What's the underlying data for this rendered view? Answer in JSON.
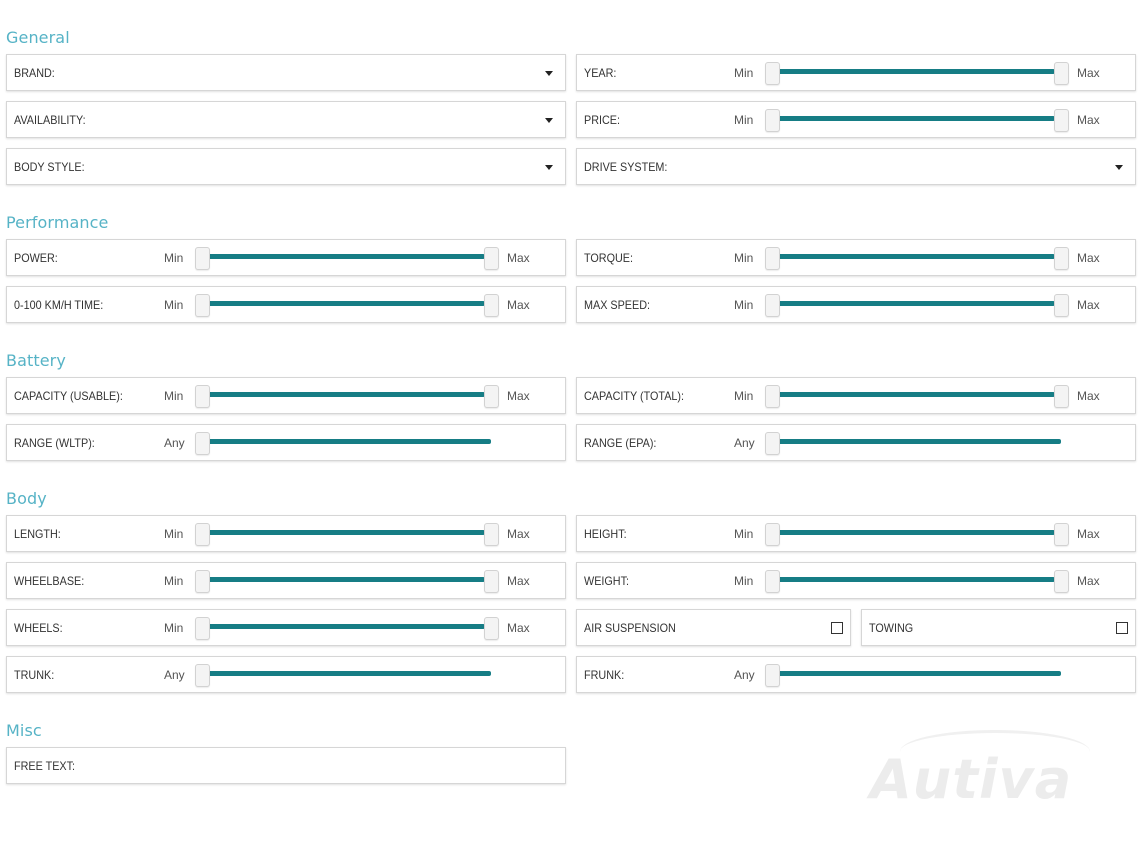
{
  "sections": {
    "general": "General",
    "performance": "Performance",
    "battery": "Battery",
    "body": "Body",
    "misc": "Misc"
  },
  "range": {
    "min": "Min",
    "max": "Max",
    "any": "Any"
  },
  "fields": {
    "brand": "BRAND:",
    "availability": "AVAILABILITY:",
    "body_style": "BODY STYLE:",
    "year": "YEAR:",
    "price": "PRICE:",
    "drive_system": "DRIVE SYSTEM:",
    "power": "POWER:",
    "torque": "TORQUE:",
    "acceleration": "0-100 KM/H TIME:",
    "max_speed": "MAX SPEED:",
    "capacity_usable": "CAPACITY (USABLE):",
    "capacity_total": "CAPACITY (TOTAL):",
    "range_wltp": "RANGE (WLTP):",
    "range_epa": "RANGE (EPA):",
    "length": "LENGTH:",
    "height": "HEIGHT:",
    "wheelbase": "WHEELBASE:",
    "weight": "WEIGHT:",
    "wheels": "WHEELS:",
    "air_suspension": "AIR SUSPENSION",
    "towing": "TOWING",
    "trunk": "TRUNK:",
    "frunk": "FRUNK:",
    "free_text": "FREE TEXT:"
  },
  "checkboxes": {
    "air_suspension": false,
    "towing": false
  },
  "logo": {
    "text": "Autiva"
  },
  "colors": {
    "accent": "#56b3c6",
    "slider": "#167d85"
  }
}
